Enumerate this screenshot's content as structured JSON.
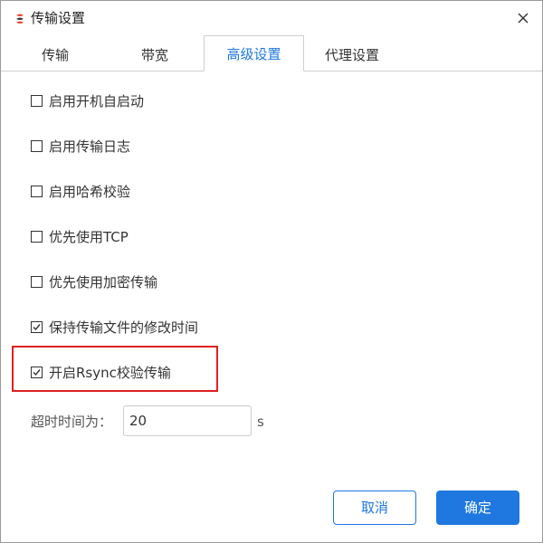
{
  "window": {
    "title": "传输设置",
    "app_icon": "app-logo-icon",
    "close_icon": "close-icon"
  },
  "tabs": [
    {
      "label": "传输",
      "active": false
    },
    {
      "label": "带宽",
      "active": false
    },
    {
      "label": "高级设置",
      "active": true
    },
    {
      "label": "代理设置",
      "active": false
    }
  ],
  "options": [
    {
      "label": "启用开机自启动",
      "checked": false
    },
    {
      "label": "启用传输日志",
      "checked": false
    },
    {
      "label": "启用哈希校验",
      "checked": false
    },
    {
      "label": "优先使用TCP",
      "checked": false
    },
    {
      "label": "优先使用加密传输",
      "checked": false
    },
    {
      "label": "保持传输文件的修改时间",
      "checked": true
    },
    {
      "label": "开启Rsync校验传输",
      "checked": true
    }
  ],
  "timeout": {
    "label": "超时时间为：",
    "value": "20",
    "unit": "s"
  },
  "buttons": {
    "cancel": "取消",
    "ok": "确定"
  },
  "colors": {
    "accent": "#1e78e0",
    "highlight": "#e02020"
  }
}
